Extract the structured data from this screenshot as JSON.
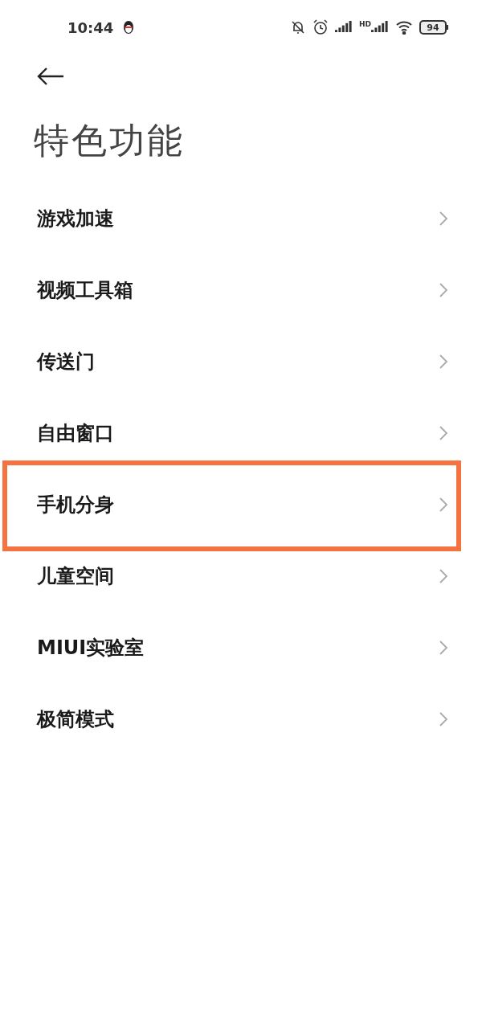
{
  "status_bar": {
    "time": "10:44",
    "hd_label": "HD",
    "battery": "94"
  },
  "title": "特色功能",
  "items": [
    {
      "label": "游戏加速",
      "highlighted": false
    },
    {
      "label": "视频工具箱",
      "highlighted": false
    },
    {
      "label": "传送门",
      "highlighted": false
    },
    {
      "label": "自由窗口",
      "highlighted": false
    },
    {
      "label": "手机分身",
      "highlighted": true
    },
    {
      "label": "儿童空间",
      "highlighted": false
    },
    {
      "label": "MIUI实验室",
      "highlighted": false
    },
    {
      "label": "极简模式",
      "highlighted": false
    }
  ]
}
